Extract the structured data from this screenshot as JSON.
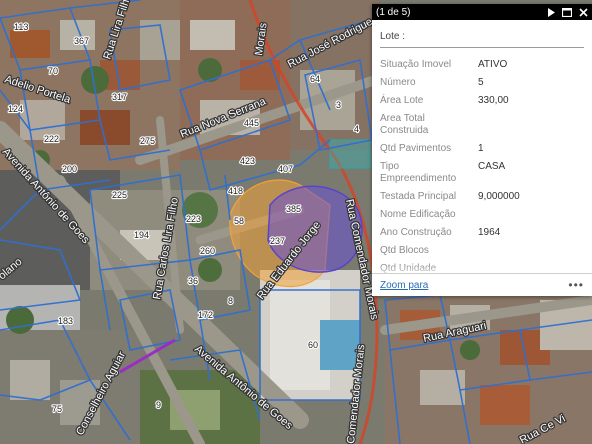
{
  "streets": {
    "rua_jose_rodrigues": "Rua José Rodrigue",
    "rua_nova_serrana": "Rua Nova Serrana",
    "rua_adelio_portela": "Adelio Portela",
    "rua_lirafilho_top": "Rua Lira Filho",
    "rua_carlos_lira_filho": "Rua Carlos Lira Filho",
    "av_antonio_de_goes_left": "Avenida Antônio de Goes",
    "av_antonio_de_goes_bottom": "Avenida Antônio de Goes",
    "rua_eduardo_jorge": "Rua Eduardo Jorge",
    "rua_comendador_morais_top": "Rua Comendador Morais",
    "rua_comendador_morais_right": "Rua Comendador Morais",
    "rua_comendador_morais_bottom": "Comendador Morais",
    "rua_araguari": "Rua Araguari",
    "rua_top_morais": "Morais",
    "rua_conselheiro_aguiar": "Conselheiro Aguiar",
    "rua_eolano": "olano",
    "rua_ce_vi": "Rua Ce Vi"
  },
  "lot_numbers": {
    "n113": "113",
    "n367": "367",
    "n70": "70",
    "n317": "317",
    "n124": "124",
    "n222": "222",
    "n200": "200",
    "n275": "275",
    "n445": "445",
    "n423": "423",
    "n407": "407",
    "n64": "64",
    "n3": "3",
    "n4": "4",
    "n225": "225",
    "n418": "418",
    "n385": "385",
    "n58": "58",
    "n223": "223",
    "n194": "194",
    "n237": "237",
    "n260": "260",
    "n36": "36",
    "n8": "8",
    "n172": "172",
    "n183": "183",
    "n60": "60",
    "n75": "75",
    "n9": "9"
  },
  "popup": {
    "counter": "(1 de 5)",
    "title": "Lote :",
    "rows": [
      {
        "key": "Situação Imovel",
        "value": "ATIVO"
      },
      {
        "key": "Número",
        "value": "5"
      },
      {
        "key": "Área Lote",
        "value": "330,00"
      },
      {
        "key": "Area Total Construida",
        "value": ""
      },
      {
        "key": "Qtd Pavimentos",
        "value": "1"
      },
      {
        "key": "Tipo Empreendimento",
        "value": "CASA"
      },
      {
        "key": "Testada Principal",
        "value": "9,000000"
      },
      {
        "key": "Nome Edificação",
        "value": ""
      },
      {
        "key": "Ano Construção",
        "value": "1964"
      },
      {
        "key": "Qtd Blocos",
        "value": ""
      },
      {
        "key": "Qtd Unidade Habit/Comercial",
        "value": ""
      }
    ],
    "zoom_label": "Zoom para",
    "more_label": "•••",
    "icons": [
      "play-icon",
      "maximize-icon",
      "close-icon"
    ]
  },
  "colors": {
    "parcel_line": "#2f6fd1",
    "street_red": "#d2452a",
    "highlight_orange": "#f0a23a",
    "highlight_purple": "#6a52d6",
    "popup_header": "#000000"
  }
}
